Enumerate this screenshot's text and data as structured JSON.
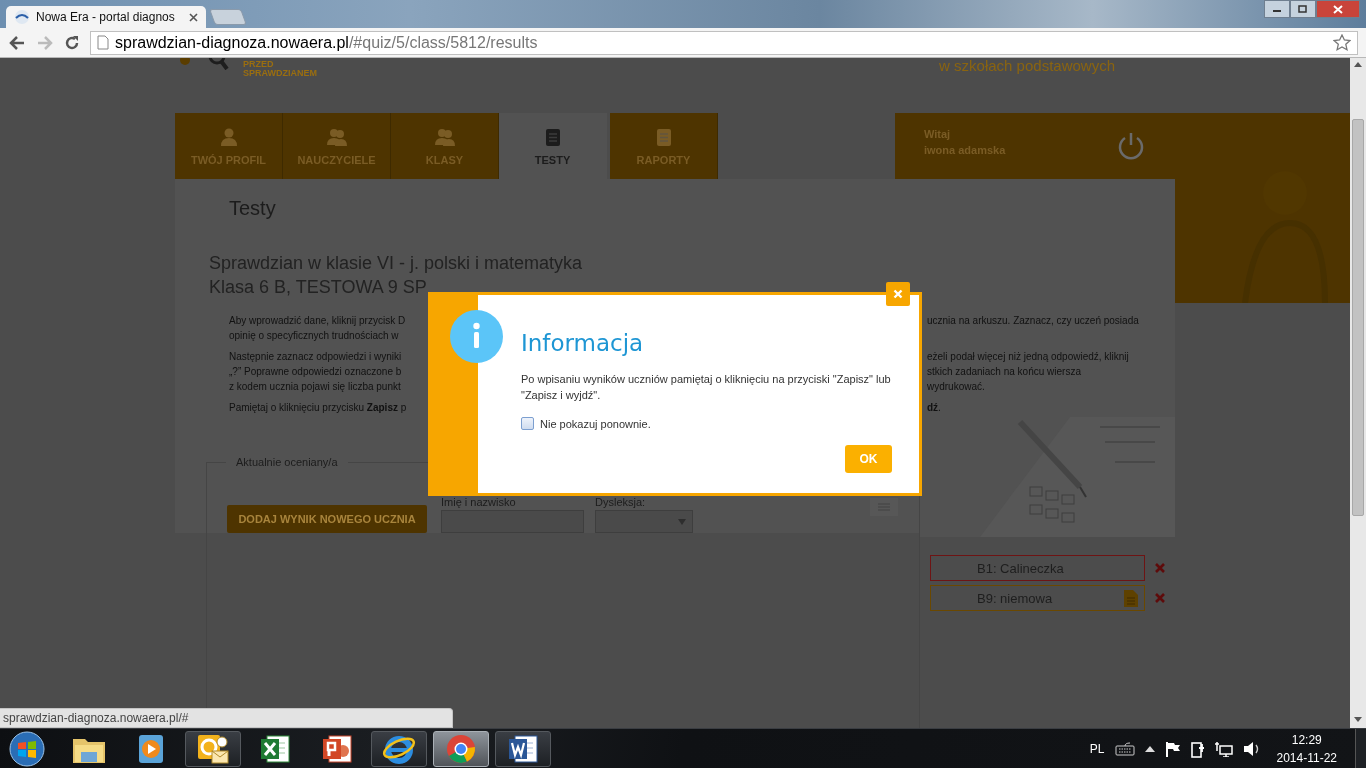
{
  "browser": {
    "tab": {
      "title": "Nowa Era - portal diagnos",
      "selected": true
    },
    "address": {
      "host": "sprawdzian-diagnoza.nowaera.pl",
      "path": "/#quiz/5/class/5812/results"
    }
  },
  "header": {
    "logo_lines": [
      "PRZED",
      "SPRAWDZIANEM"
    ],
    "tagline": "w szkołach podstawowych"
  },
  "nav": [
    {
      "label": "TWÓJ PROFIL",
      "kind": "user",
      "selected": false
    },
    {
      "label": "NAUCZYCIELE",
      "kind": "users",
      "selected": false
    },
    {
      "label": "KLASY",
      "kind": "users",
      "selected": false
    },
    {
      "label": "TESTY",
      "kind": "document",
      "selected": true
    },
    {
      "label": "RAPORTY",
      "kind": "document",
      "selected": false
    }
  ],
  "user_box": {
    "greeting": "Witaj",
    "name": "iwona adamska"
  },
  "page_title": "Testy",
  "test_title": [
    "Sprawdzian w klasie VI - j. polski i matematyka",
    "Klasa 6 B, TESTOWA 9 SP"
  ],
  "instructions": [
    [
      {
        "left": "Aby wprowadzić dane, kliknij przycisk D",
        "right": "ucznia na arkuszu. Zaznacz, czy uczeń posiada"
      },
      {
        "left": "opinię o specyficznych trudnościach w"
      }
    ],
    [
      {
        "left": "Następnie zaznacz odpowiedzi i wyniki",
        "right": "eżeli podał więcej niż jedną odpowiedź, kliknij"
      },
      {
        "left": "„?” Poprawne odpowiedzi oznaczone b",
        "right": "stkich zadaniach na końcu wiersza"
      },
      {
        "left": "z kodem ucznia pojawi się liczba punkt",
        "right": "wydrukować."
      }
    ],
    [
      {
        "left": "Pamiętaj o kliknięciu przycisku **Zapisz** p",
        "right": "**dź**."
      }
    ]
  ],
  "form": {
    "legend": "Aktualnie oceniany/a",
    "add_button": "DODAJ WYNIK NOWEGO UCZNIA",
    "name_label": "Imię i nazwisko",
    "dyslexia_label": "Dysleksja:"
  },
  "students": [
    {
      "label": "B1: Calineczka",
      "kind": "error"
    },
    {
      "label": "B9: niemowa",
      "kind": "document"
    }
  ],
  "modal": {
    "title": "Informacja",
    "message": "Po wpisaniu wyników uczniów pamiętaj o kliknięciu na przyciski \"Zapisz\" lub \"Zapisz i wyjdź\".",
    "checkbox": {
      "label": "Nie pokazuj ponownie.",
      "checked": false
    },
    "ok": "OK"
  },
  "status_url": "sprawdzian-diagnoza.nowaera.pl/#",
  "taskbar": {
    "apps": [
      {
        "kind": "folder",
        "running": false,
        "selected": false
      },
      {
        "kind": "player",
        "running": false,
        "selected": false
      },
      {
        "kind": "mail",
        "running": true,
        "selected": false
      },
      {
        "kind": "sheet",
        "running": false,
        "selected": false
      },
      {
        "kind": "slides",
        "running": false,
        "selected": false
      },
      {
        "kind": "globe",
        "running": true,
        "selected": false
      },
      {
        "kind": "wheel",
        "running": true,
        "selected": true
      },
      {
        "kind": "doc",
        "running": true,
        "selected": false
      }
    ],
    "language": "PL",
    "time": "12:29",
    "date": "2014-11-22"
  }
}
